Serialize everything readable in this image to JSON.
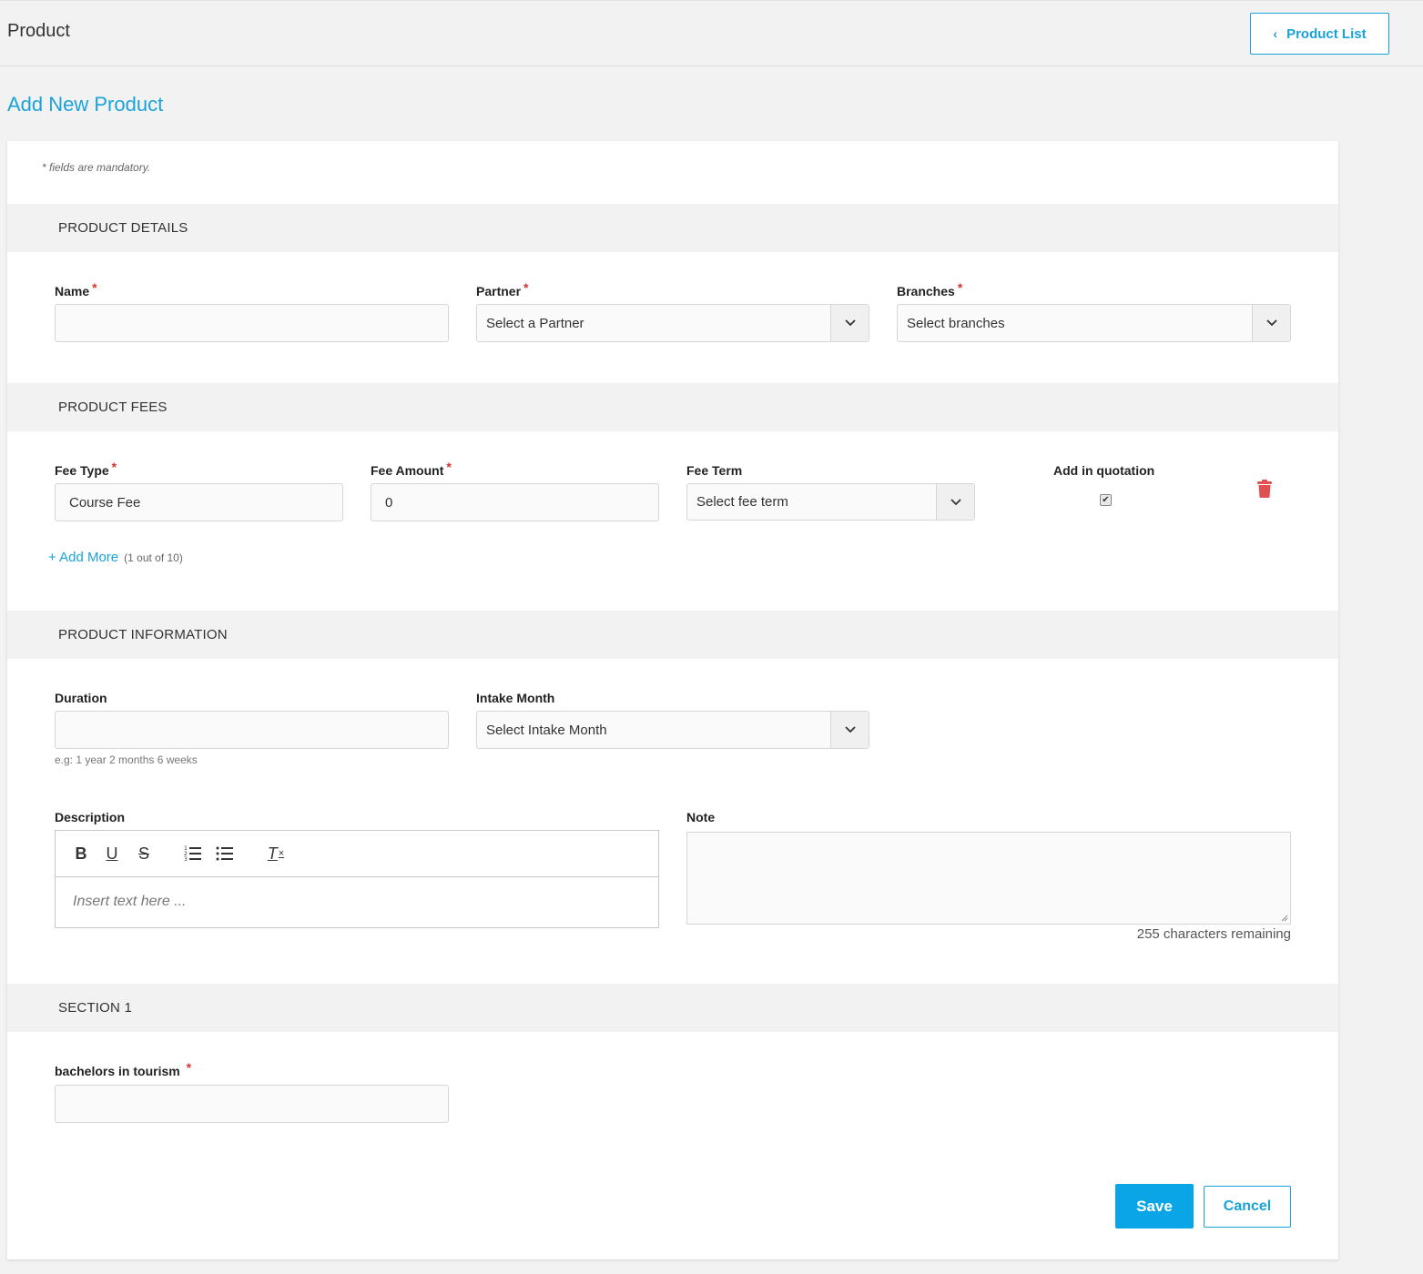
{
  "header": {
    "title": "Product",
    "product_list_label": "Product List"
  },
  "page_heading": "Add New Product",
  "form": {
    "mandatory_note": "* fields are mandatory.",
    "required_mark": "*",
    "sections": {
      "details": "PRODUCT DETAILS",
      "fees": "PRODUCT FEES",
      "information": "PRODUCT INFORMATION",
      "section1": "SECTION 1"
    },
    "details": {
      "name_label": "Name",
      "name_value": "",
      "partner_label": "Partner",
      "partner_value": "Select a Partner",
      "branches_label": "Branches",
      "branches_value": "Select branches"
    },
    "fees": {
      "fee_type_label": "Fee Type",
      "fee_type_value": "Course Fee",
      "fee_amount_label": "Fee Amount",
      "fee_amount_value": "0",
      "fee_term_label": "Fee Term",
      "fee_term_value": "Select fee term",
      "add_in_quotation_label": "Add in quotation",
      "add_in_quotation_checked": true,
      "add_more_label": "+ Add More",
      "add_more_count": "(1 out of 10)"
    },
    "information": {
      "duration_label": "Duration",
      "duration_value": "",
      "duration_hint": "e.g: 1 year 2 months 6 weeks",
      "intake_label": "Intake Month",
      "intake_value": "Select Intake Month",
      "description_label": "Description",
      "description_placeholder": "Insert text here ...",
      "note_label": "Note",
      "note_remaining": "255 characters remaining"
    },
    "section1": {
      "field_label": "bachelors in tourism",
      "field_value": ""
    },
    "save_label": "Save",
    "cancel_label": "Cancel"
  },
  "colors": {
    "accent": "#1aa3d9",
    "save_bg": "#0aa5e6",
    "required": "#d9342b",
    "delete": "#e05050"
  },
  "icons": [
    "chevron-left-icon",
    "chevron-down-icon",
    "trash-icon",
    "bold-icon",
    "underline-icon",
    "strikethrough-icon",
    "ordered-list-icon",
    "bullet-list-icon",
    "clear-format-icon",
    "resize-grip-icon"
  ]
}
